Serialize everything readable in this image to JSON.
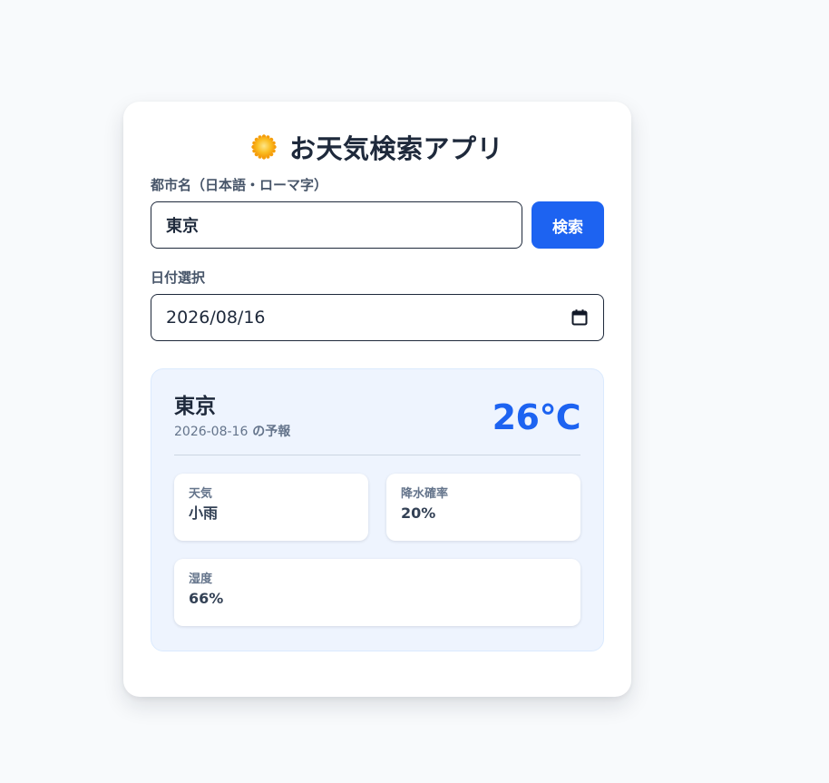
{
  "app": {
    "title": "お天気検索アプリ",
    "icon": "sun-icon"
  },
  "search": {
    "label": "都市名（日本語・ローマ字）",
    "value": "東京",
    "button_label": "検索"
  },
  "date": {
    "label": "日付選択",
    "value": "2026/08/16",
    "icon": "calendar-icon"
  },
  "result": {
    "city": "東京",
    "date": "2026-08-16",
    "date_suffix": " の予報",
    "temperature": "26℃",
    "stats": [
      {
        "label": "天気",
        "value": "小雨"
      },
      {
        "label": "降水確率",
        "value": "20%"
      },
      {
        "label": "湿度",
        "value": "66%"
      }
    ]
  },
  "colors": {
    "accent": "#1d63f1",
    "background": "#f8fafc",
    "panel": "#eef4fe",
    "text": "#1e293b"
  }
}
